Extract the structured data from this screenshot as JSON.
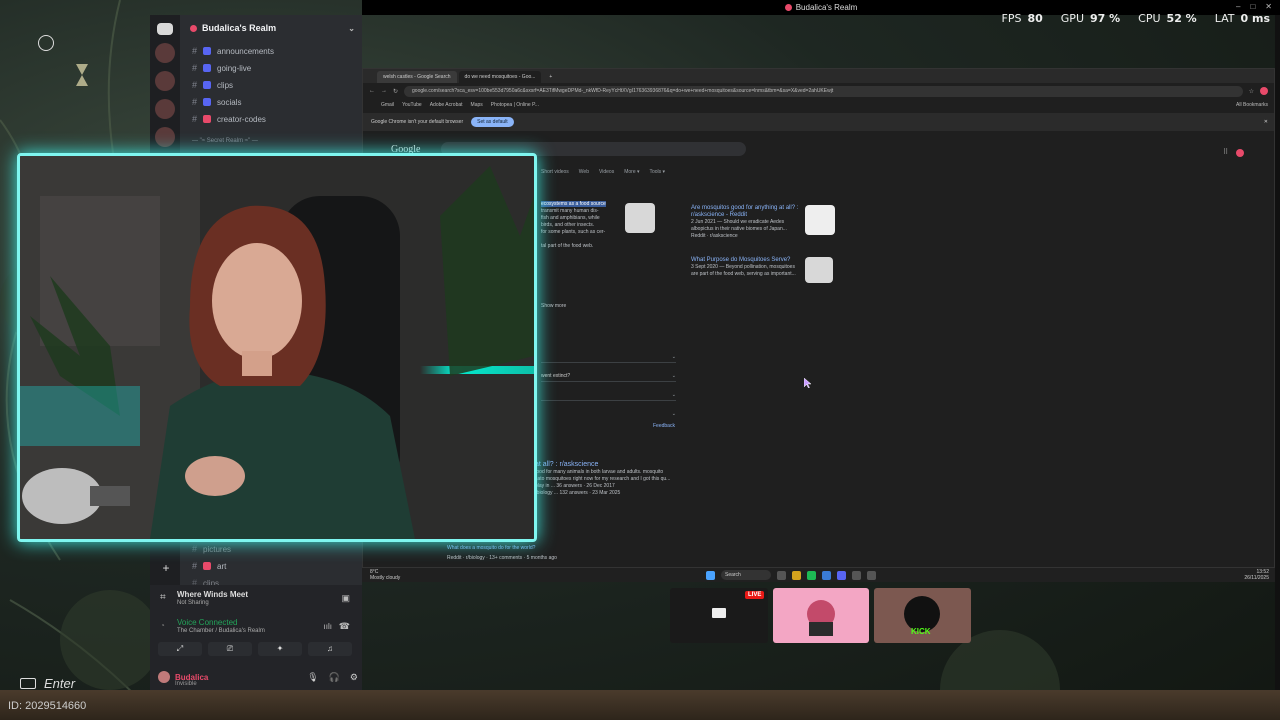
{
  "window_title": "Budalica's Realm",
  "perf": {
    "fps_label": "FPS",
    "fps": "80",
    "gpu_label": "GPU",
    "gpu": "97 %",
    "cpu_label": "CPU",
    "cpu": "52 %",
    "lat_label": "LAT",
    "lat": "0 ms"
  },
  "discord": {
    "server_name": "Budalica's Realm",
    "channels": [
      {
        "label": "announcements"
      },
      {
        "label": "going-live"
      },
      {
        "label": "clips"
      },
      {
        "label": "socials"
      },
      {
        "label": "creator-codes"
      }
    ],
    "hidden_category": "— \"≈ Secret Realm ≈\" —",
    "lower_channels": [
      {
        "label": "pictures"
      },
      {
        "label": "art"
      },
      {
        "label": "clips"
      }
    ],
    "game": {
      "title": "Where Winds Meet",
      "subtitle": "Not Sharing"
    },
    "voice": {
      "status": "Voice Connected",
      "location": "The Chamber / Budalica's Realm"
    },
    "user": {
      "name": "Budalica",
      "status": "Invisible"
    }
  },
  "browser": {
    "tabs": [
      "welsh castles - Google Search",
      "do we need mosquitoes - Goo..."
    ],
    "url": "google.com/search?sca_esv=100be553d7950a6c&sxsrf=AE3TifMwgeDPMd-_nkWfD-ReyYcHtXVgI176363936876&q=do+we+need+mosquitoes&source=lnms&tbm=&sa=X&ved=2ahUKEwjt",
    "bookmarks": [
      "Gmail",
      "YouTube",
      "Adobe Acrobat",
      "Maps",
      "Photopea | Online P..."
    ],
    "all_bookmarks": "All Bookmarks",
    "infobar_text": "Google Chrome isn't your default browser",
    "infobar_button": "Set as default",
    "google_logo": "Google",
    "filters": [
      "Short videos",
      "Web",
      "Videos",
      "More ▾",
      "Tools ▾"
    ],
    "snippet_highlight": "ecosystems as a food source",
    "snippet_lines": [
      "transmit many human dis-",
      "fish and amphibians, while",
      "birds, and other insects.",
      "for some plants, such as cer-"
    ],
    "snippet_tail": "tal part of the food web.",
    "show_more": "Show more",
    "side_results": [
      {
        "title": "Are mosquitos good for anything at all? : r/askscience - Reddit",
        "meta": "2 Jun 2021 — Should we eradicate Aedes albopictus in their native biomes of Japan...",
        "source": "Reddit · r/askscience"
      },
      {
        "title": "What Purpose do Mosquitoes Serve?",
        "meta": "3 Sept 2020 — Beyond pollination, mosquitoes are part of the food web, serving as important..."
      }
    ],
    "paa_question": "went extinct?",
    "feedback": "Feedback",
    "reddit_result": {
      "title": "at all? : r/askscience",
      "line1": "food for many animals in both larvae and adults. mosquito",
      "line2": "sato mosquitoes right now for my research and I got this qu...",
      "line3": "play in ... 36 answers · 26 Dec 2017",
      "line4": "rbiology ... 132 answers · 23 Mar 2025"
    },
    "bottom_result": "What does a mosquito do for the world?",
    "bottom_source": "Reddit · r/biology · 13+ comments · 5 months ago"
  },
  "win_taskbar": {
    "weather_temp": "8°C",
    "weather_desc": "Mostly cloudy",
    "search_label": "Search",
    "time": "13:52",
    "date": "26/11/2025"
  },
  "stream": {
    "live": "LIVE",
    "kick": "KICK"
  },
  "overlay": {
    "enter": "Enter",
    "id": "ID: 2029514660"
  },
  "colors": {
    "webcam_border": "#7ff6f0",
    "discord_bg": "#2b2d31",
    "voice_green": "#23a55a",
    "live_red": "#e91916",
    "kick_green": "#53fc18"
  }
}
